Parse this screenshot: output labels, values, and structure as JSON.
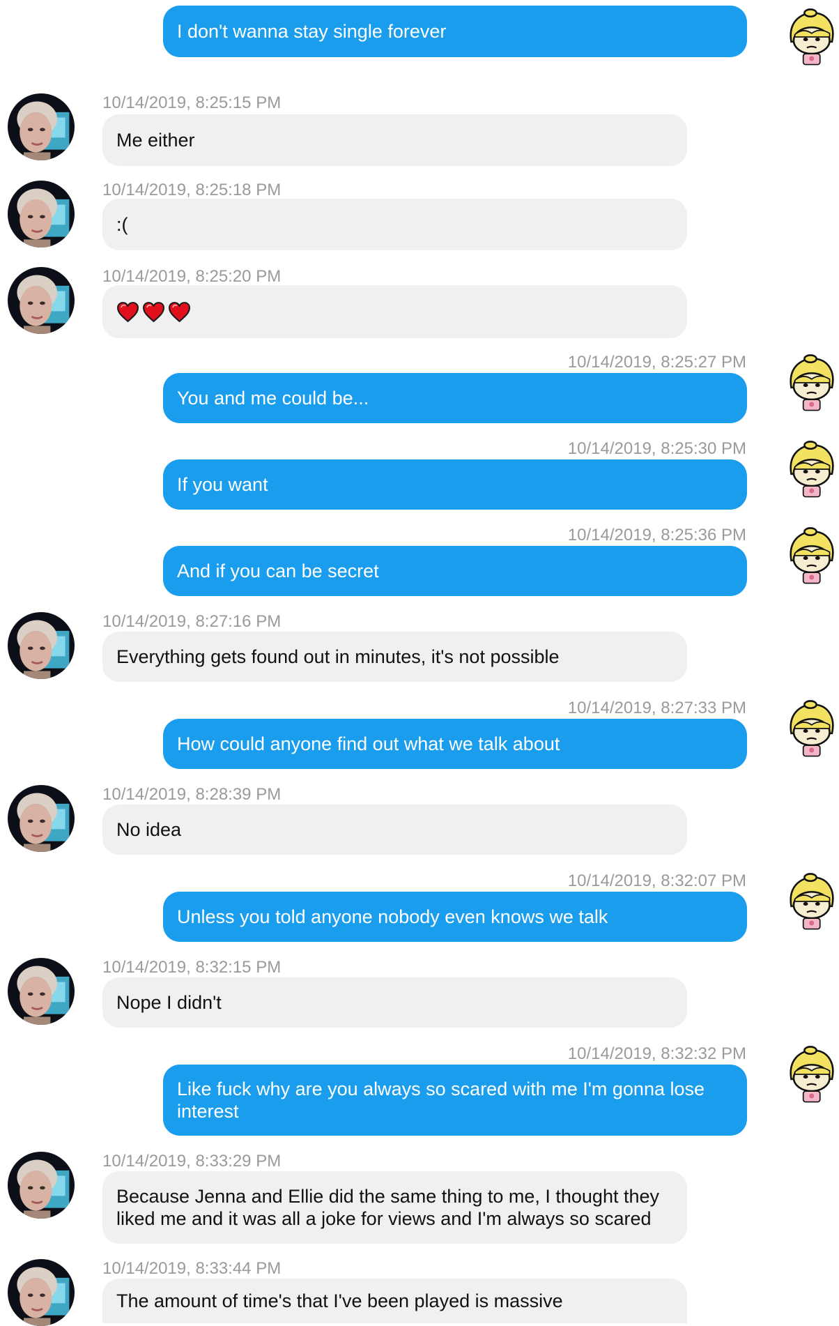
{
  "colors": {
    "outgoing_bubble": "#1b9ded",
    "incoming_bubble": "#f0f0f0",
    "timestamp": "#9a9a9a"
  },
  "messages": [
    {
      "direction": "out",
      "timestamp": "",
      "text": "I don't wanna stay single forever"
    },
    {
      "direction": "in",
      "timestamp": "10/14/2019, 8:25:15 PM",
      "text": "Me either"
    },
    {
      "direction": "in",
      "timestamp": "10/14/2019, 8:25:18 PM",
      "text": ":("
    },
    {
      "direction": "in",
      "timestamp": "10/14/2019, 8:25:20 PM",
      "text": "",
      "emoji": [
        "red-heart-icon",
        "red-heart-icon",
        "red-heart-icon"
      ]
    },
    {
      "direction": "out",
      "timestamp": "10/14/2019, 8:25:27 PM",
      "text": "You and me could be..."
    },
    {
      "direction": "out",
      "timestamp": "10/14/2019, 8:25:30 PM",
      "text": "If you want"
    },
    {
      "direction": "out",
      "timestamp": "10/14/2019, 8:25:36 PM",
      "text": "And if you can be secret"
    },
    {
      "direction": "in",
      "timestamp": "10/14/2019, 8:27:16 PM",
      "text": "Everything gets found out in minutes, it's not possible"
    },
    {
      "direction": "out",
      "timestamp": "10/14/2019, 8:27:33 PM",
      "text": "How could anyone find out what we talk about"
    },
    {
      "direction": "in",
      "timestamp": "10/14/2019, 8:28:39 PM",
      "text": "No idea"
    },
    {
      "direction": "out",
      "timestamp": "10/14/2019, 8:32:07 PM",
      "text": "Unless you told anyone nobody even knows we talk"
    },
    {
      "direction": "in",
      "timestamp": "10/14/2019, 8:32:15 PM",
      "text": "Nope I didn't"
    },
    {
      "direction": "out",
      "timestamp": "10/14/2019, 8:32:32 PM",
      "text": "Like fuck why are you always so scared with me I'm gonna lose interest"
    },
    {
      "direction": "in",
      "timestamp": "10/14/2019, 8:33:29 PM",
      "text": "Because Jenna and Ellie did the same thing to me, I thought they liked me and it was all a joke for views and I'm always so scared"
    },
    {
      "direction": "in",
      "timestamp": "10/14/2019, 8:33:44 PM",
      "text": "The amount of time's that I've been played is massive"
    }
  ]
}
